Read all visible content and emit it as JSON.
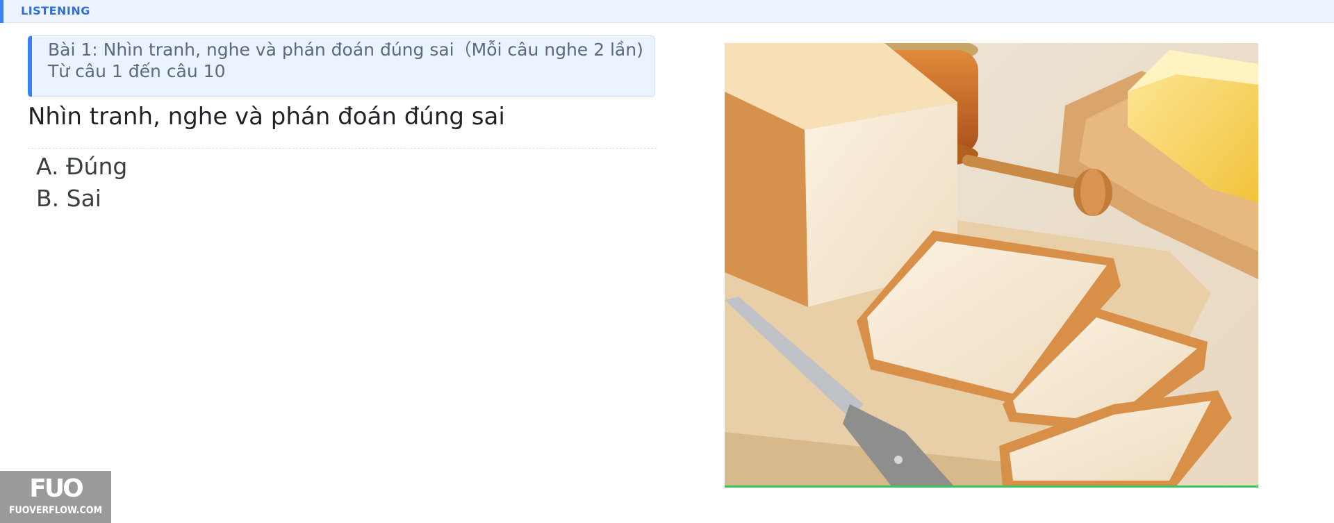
{
  "header": {
    "title": "LISTENING",
    "accent_color": "#3b82f6"
  },
  "instruction": {
    "line1": "Bài 1: Nhìn tranh, nghe và phán đoán đúng sai（Mỗi câu nghe 2 lần)",
    "line2": "Từ câu 1 đến câu 10"
  },
  "question": {
    "text": "Nhìn tranh, nghe và phán đoán đúng sai"
  },
  "options": [
    {
      "label": "A. Đúng"
    },
    {
      "label": "B. Sai"
    }
  ],
  "image": {
    "subject": "bread-loaf-photo"
  },
  "watermark": {
    "logo": "FUO",
    "site": "FUOVERFLOW.COM"
  }
}
